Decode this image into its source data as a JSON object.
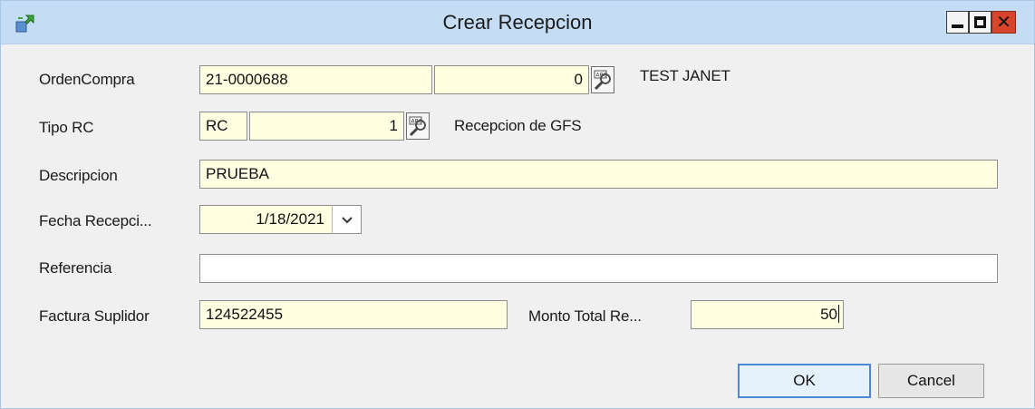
{
  "window": {
    "title": "Crear Recepcion",
    "close_glyph": "✕",
    "icons": [
      "app-icon",
      "minimize-icon",
      "maximize-icon",
      "close-icon"
    ]
  },
  "form": {
    "orden_compra": {
      "label": "OrdenCompra",
      "value1": "21-0000688",
      "value2": "0",
      "description": "TEST JANET"
    },
    "tipo_rc": {
      "label": "Tipo RC",
      "code": "RC",
      "number": "1",
      "description": "Recepcion de GFS"
    },
    "descripcion": {
      "label": "Descripcion",
      "value": "PRUEBA"
    },
    "fecha_recepcion": {
      "label": "Fecha Recepci...",
      "value": "1/18/2021"
    },
    "referencia": {
      "label": "Referencia",
      "value": ""
    },
    "factura_suplidor": {
      "label": "Factura Suplidor",
      "value": "124522455"
    },
    "monto_total": {
      "label": "Monto Total Re...",
      "value": "50"
    }
  },
  "buttons": {
    "ok": "OK",
    "cancel": "Cancel"
  },
  "colors": {
    "input_background": "#ffffe1",
    "titlebar": "#c4dcf4",
    "close_button": "#d6452c",
    "default_button_border": "#4a89d2"
  }
}
